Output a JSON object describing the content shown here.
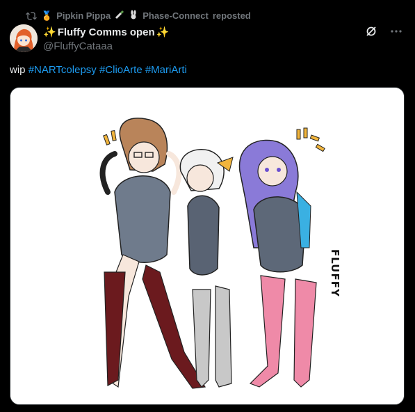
{
  "repost": {
    "reposter_1": "Pipkin Pippa",
    "reposter_2": "Phase-Connect",
    "suffix": "reposted"
  },
  "author": {
    "display_name": "Fluffy Comms open",
    "handle": "@FluffyCataaa"
  },
  "tweet": {
    "prefix": "wip",
    "hashtags": [
      "#NARTcolepsy",
      "#ClioArte",
      "#MariArti"
    ]
  },
  "media": {
    "signature": "FLUFFY"
  },
  "icons": {
    "repost": "repost-icon",
    "grok": "grok-icon",
    "more": "more-icon"
  },
  "colors": {
    "background": "#000000",
    "text": "#e7e9ea",
    "muted": "#71767b",
    "link": "#1d9bf0"
  }
}
